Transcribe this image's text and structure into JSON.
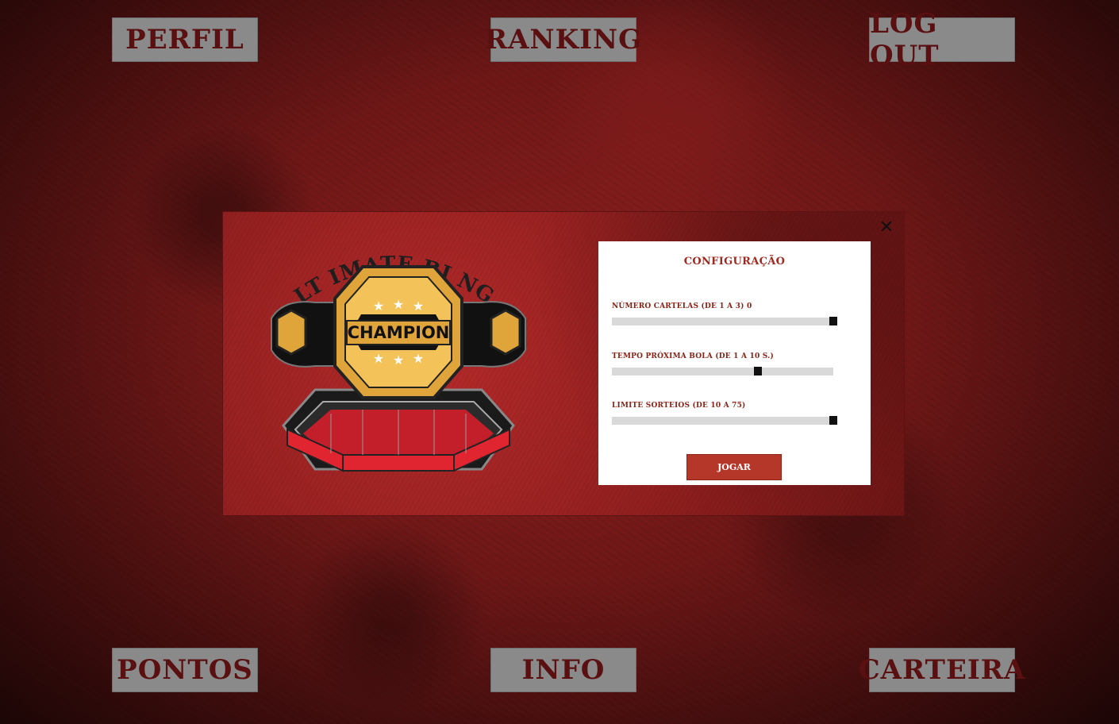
{
  "nav": {
    "perfil": "PERFIL",
    "ranking": "RANKING",
    "logout": "LOG OUT",
    "pontos": "PONTOS",
    "info": "INFO",
    "carteira": "CARTEIRA"
  },
  "modal": {
    "close_icon": "close-icon",
    "logo": {
      "arc_text": "ULT IMATE BI NGO",
      "badge_text": "CHAMPION"
    },
    "config": {
      "title": "CONFIGURAÇÃO",
      "fields": [
        {
          "label": "Número cartelas (de 1 a 3) 0",
          "value_fraction": 1.0
        },
        {
          "label": "Tempo próxima bola (de 1 a 10 s.)",
          "value_fraction": 0.66
        },
        {
          "label": "Limite sorteios (de 10 a 75)",
          "value_fraction": 1.0
        }
      ],
      "play_button": "JOGAR"
    }
  },
  "colors": {
    "nav_text": "#5a1010",
    "nav_bg": "#8a8a8a",
    "accent": "#b5372a",
    "badge_gold": "#e0a53a"
  }
}
